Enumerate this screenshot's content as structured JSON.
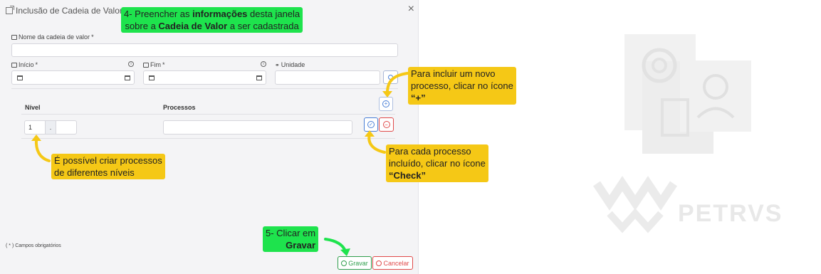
{
  "modal": {
    "title": "Inclusão de Cadeia de Valor",
    "close_glyph": "×",
    "fields": {
      "nome_label": "Nome da cadeia de valor",
      "required_mark": "*",
      "inicio_label": "Início",
      "fim_label": "Fim",
      "unidade_label": "Unidade"
    },
    "table": {
      "col_nivel": "Nível",
      "col_processos": "Processos",
      "nivel_value": "1",
      "nivel_sep": "."
    },
    "footer_note": "( * ) Campos obrigatórios",
    "buttons": {
      "gravar": "Gravar",
      "cancelar": "Cancelar"
    }
  },
  "annotations": {
    "step4_prefix": "4-  Preencher as ",
    "step4_bold1": "informações",
    "step4_mid": " desta janela",
    "step4_line2_pre": "sobre a ",
    "step4_bold2": "Cadeia de Valor",
    "step4_line2_post": " a ser cadastrada",
    "plus_line1": "Para incluir um novo",
    "plus_line2": "processo, clicar no ícone",
    "plus_line3": "“+”",
    "levels_line1": " É possível criar processos",
    "levels_line2": "de diferentes níveis",
    "check_line1": "Para cada processo",
    "check_line2": "incluído, clicar no ícone",
    "check_line3": "“Check”",
    "step5_line1": "5- Clicar em",
    "step5_line2": "Gravar"
  },
  "logo": {
    "text": "PETRVS"
  },
  "colors": {
    "modal_bg": "#f4f4f6",
    "yellow_note": "#f5c816",
    "green_note": "#1ee34d",
    "success": "#2f9e4c",
    "danger": "#e04a4a",
    "primary": "#4a7fd6"
  }
}
